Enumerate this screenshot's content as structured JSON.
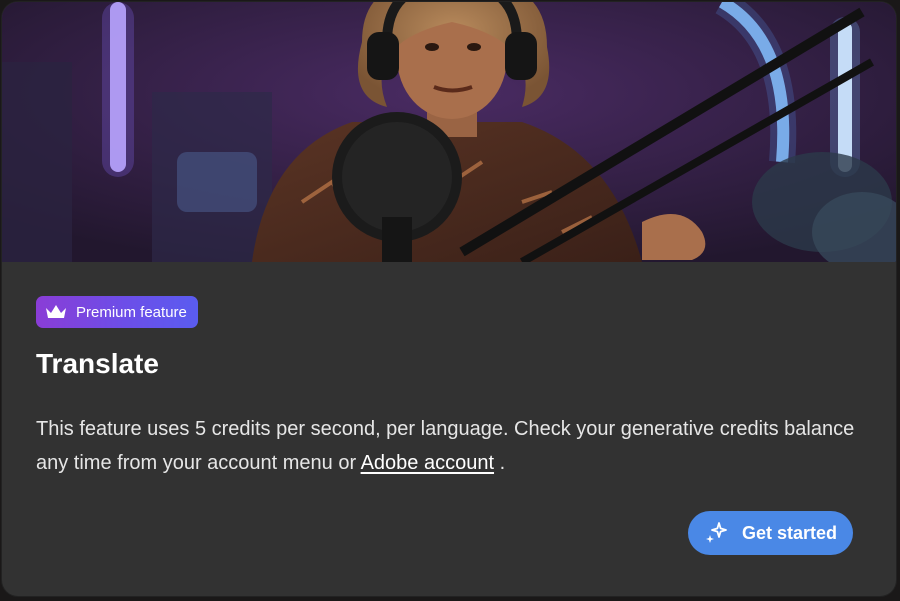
{
  "dialog": {
    "hero_alt": "Podcaster with headphones speaking into a studio microphone",
    "badge": {
      "icon": "crown-icon",
      "label": "Premium feature",
      "gradient_start": "#8a3dd6",
      "gradient_end": "#5a5cf0"
    },
    "title": "Translate",
    "description_part1": "This feature uses 5 credits per second, per language. Check your generative credits balance any time from your account menu or ",
    "description_link": "Adobe account",
    "description_end": " .",
    "cta": {
      "label": "Get started",
      "icon": "sparkle-icon",
      "color": "#4a88e6"
    }
  }
}
